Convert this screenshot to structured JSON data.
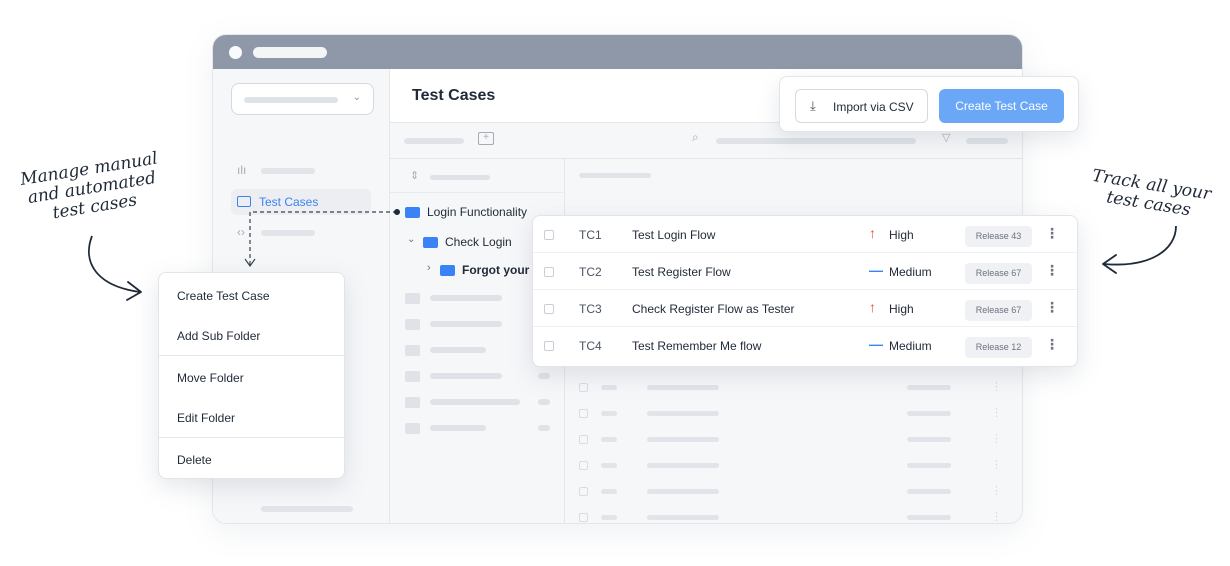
{
  "header": {
    "title": "Test Cases"
  },
  "sidebar": {
    "active_item_label": "Test Cases"
  },
  "actions": {
    "import_label": "Import via CSV",
    "create_label": "Create Test Case"
  },
  "folder_tree": {
    "items": [
      {
        "label": "Login Functionality"
      },
      {
        "label": "Check Login"
      },
      {
        "label": "Forgot your I"
      }
    ]
  },
  "test_cases": [
    {
      "id": "TC1",
      "name": "Test Login Flow",
      "priority": "High",
      "priority_icon": "arrow-up-icon",
      "release": "Release 43"
    },
    {
      "id": "TC2",
      "name": "Test Register Flow",
      "priority": "Medium",
      "priority_icon": "dash-icon",
      "release": "Release 67"
    },
    {
      "id": "TC3",
      "name": "Check Register Flow as Tester",
      "priority": "High",
      "priority_icon": "arrow-up-icon",
      "release": "Release 67"
    },
    {
      "id": "TC4",
      "name": "Test Remember Me flow",
      "priority": "Medium",
      "priority_icon": "dash-icon",
      "release": "Release 12"
    }
  ],
  "context_menu": {
    "items": [
      {
        "label": "Create Test Case"
      },
      {
        "label": "Add Sub Folder"
      },
      {
        "label": "Move Folder"
      },
      {
        "label": "Edit Folder"
      },
      {
        "label": "Delete"
      }
    ]
  },
  "annotations": {
    "left": [
      "Manage manual",
      "and automated",
      "test cases"
    ],
    "right": [
      "Track all your",
      "test cases"
    ]
  },
  "colors": {
    "accent": "#3b82f6",
    "primary_button": "#6aa7f7",
    "priority_high": "#e0533d",
    "priority_medium": "#3b82f6",
    "titlebar": "#8f98a8"
  }
}
